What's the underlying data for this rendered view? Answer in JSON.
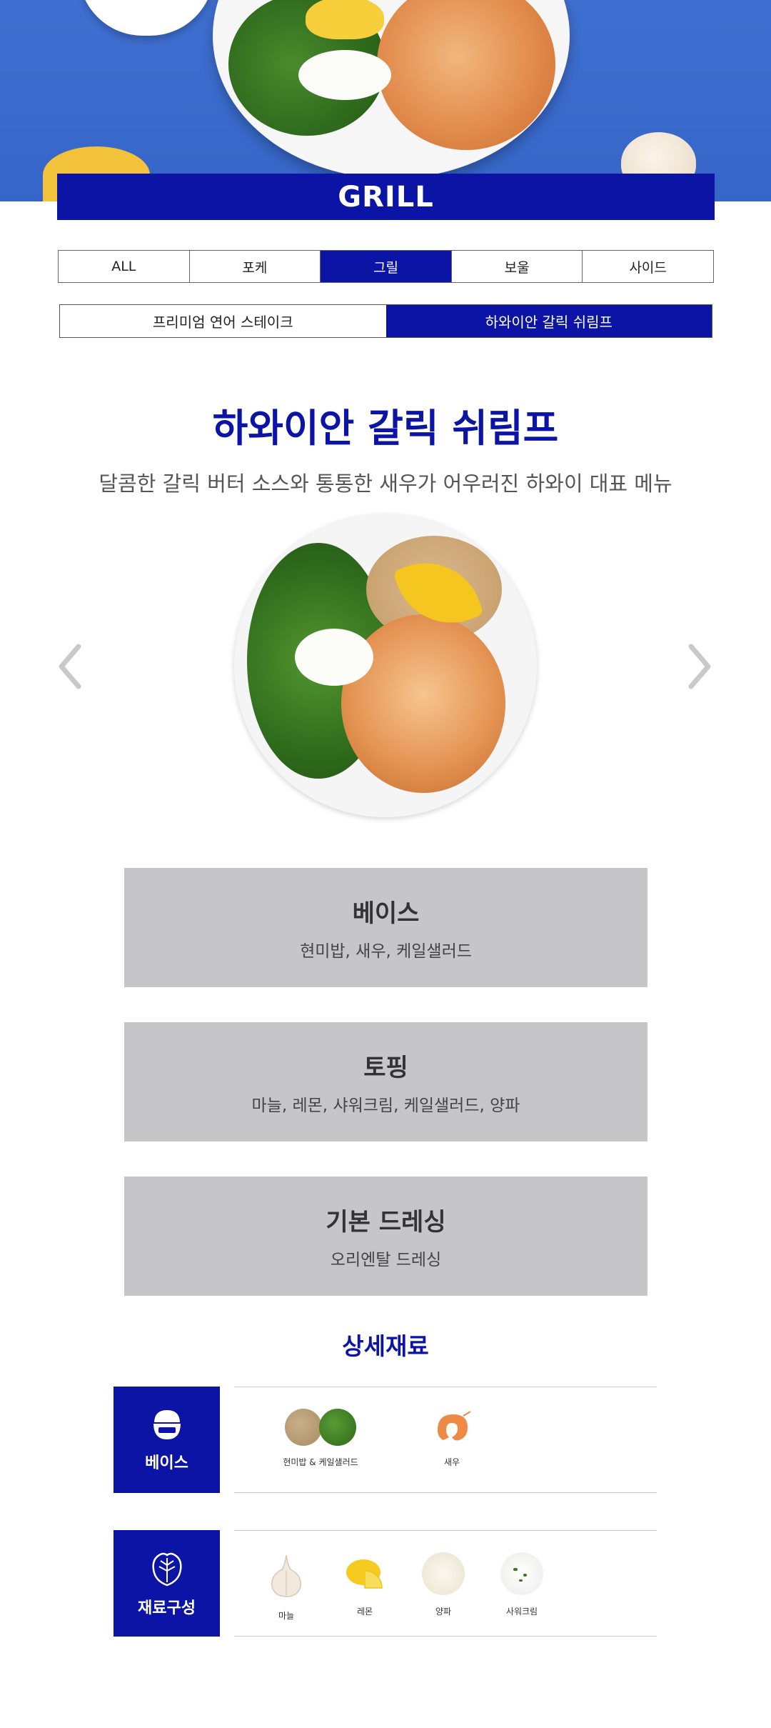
{
  "header": {
    "category_banner": "GRILL"
  },
  "category_tabs": [
    {
      "label": "ALL",
      "active": false
    },
    {
      "label": "포케",
      "active": false
    },
    {
      "label": "그릴",
      "active": true
    },
    {
      "label": "보울",
      "active": false
    },
    {
      "label": "사이드",
      "active": false
    }
  ],
  "sub_tabs": [
    {
      "label": "프리미엄 연어 스테이크",
      "active": false
    },
    {
      "label": "하와이안 갈릭 쉬림프",
      "active": true
    }
  ],
  "menu": {
    "title": "하와이안 갈릭 쉬림프",
    "description": "달콤한 갈릭 버터 소스와 통통한 새우가 어우러진 하와이 대표 메뉴"
  },
  "info_boxes": [
    {
      "title": "베이스",
      "content": "현미밥, 새우, 케일샐러드"
    },
    {
      "title": "토핑",
      "content": "마늘, 레몬, 샤워크림, 케일샐러드, 양파"
    },
    {
      "title": "기본 드레싱",
      "content": "오리엔탈 드레싱"
    }
  ],
  "details": {
    "title": "상세재료",
    "base": {
      "label": "베이스",
      "items": [
        {
          "name": "현미밥 & 케일샐러드"
        },
        {
          "name": "새우"
        }
      ]
    },
    "ingredients": {
      "label": "재료구성",
      "items": [
        {
          "name": "마늘"
        },
        {
          "name": "레몬"
        },
        {
          "name": "양파"
        },
        {
          "name": "사워크림"
        }
      ]
    }
  },
  "colors": {
    "brand_blue": "#0b14a5",
    "hero_blue": "#3565c6",
    "info_box_gray": "#c6c6c9"
  },
  "icons": {
    "prev": "chevron-left-icon",
    "next": "chevron-right-icon",
    "base": "rice-bowl-icon",
    "ingredients": "lettuce-icon"
  }
}
